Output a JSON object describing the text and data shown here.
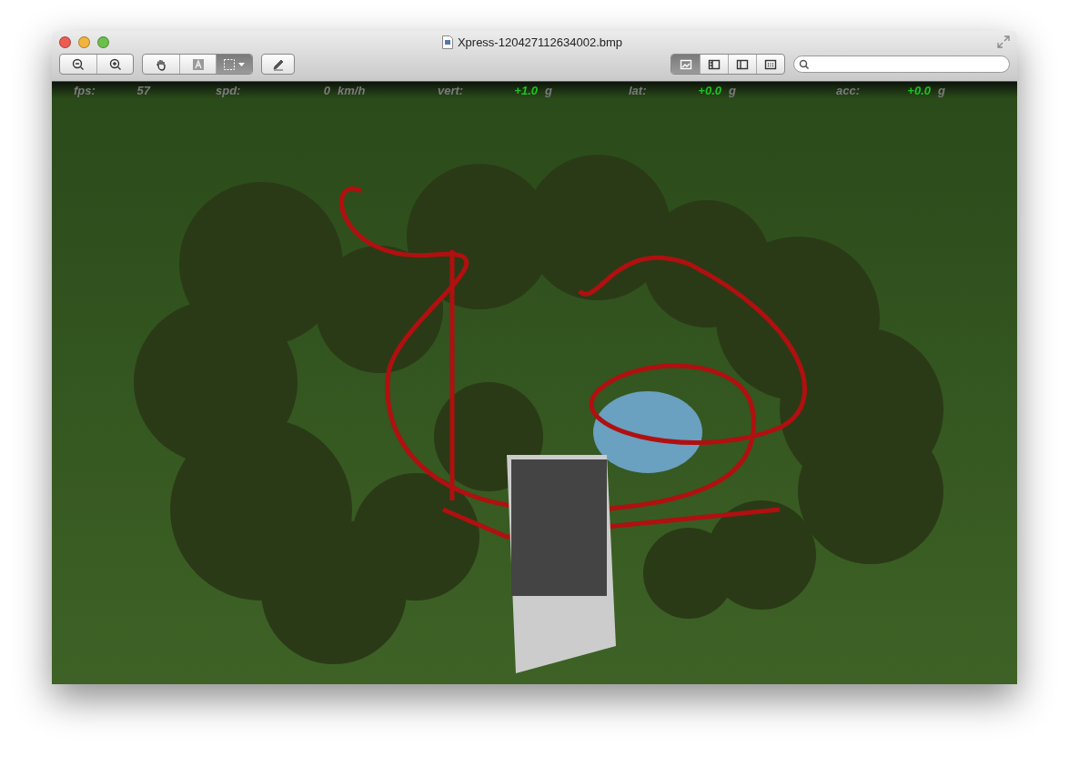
{
  "window": {
    "title": "Xpress-120427112634002.bmp"
  },
  "toolbar": {
    "zoom_buttons": [
      {
        "kind": "zoom-out",
        "selected": false
      },
      {
        "kind": "zoom-in",
        "selected": false
      }
    ],
    "tool_buttons": [
      {
        "kind": "hand",
        "selected": false
      },
      {
        "kind": "text",
        "selected": false
      },
      {
        "kind": "select",
        "selected": true
      }
    ],
    "view_buttons": [
      {
        "kind": "content",
        "selected": true
      },
      {
        "kind": "thumbnails",
        "selected": false
      },
      {
        "kind": "sidebar",
        "selected": false
      },
      {
        "kind": "contact",
        "selected": false
      }
    ]
  },
  "hud": [
    {
      "label": "fps:",
      "value": "57",
      "color": "#7a7a7a"
    },
    {
      "label": "spd:",
      "value": "0",
      "unit": "km/h",
      "color": "#7a7a7a"
    },
    {
      "label": "vert:",
      "value": "+1.0",
      "unit": "g",
      "color": "#1ec21e"
    },
    {
      "label": "lat:",
      "value": "+0.0",
      "unit": "g",
      "color": "#1ec21e"
    },
    {
      "label": "acc:",
      "value": "+0.0",
      "unit": "g",
      "color": "#1ec21e"
    }
  ]
}
